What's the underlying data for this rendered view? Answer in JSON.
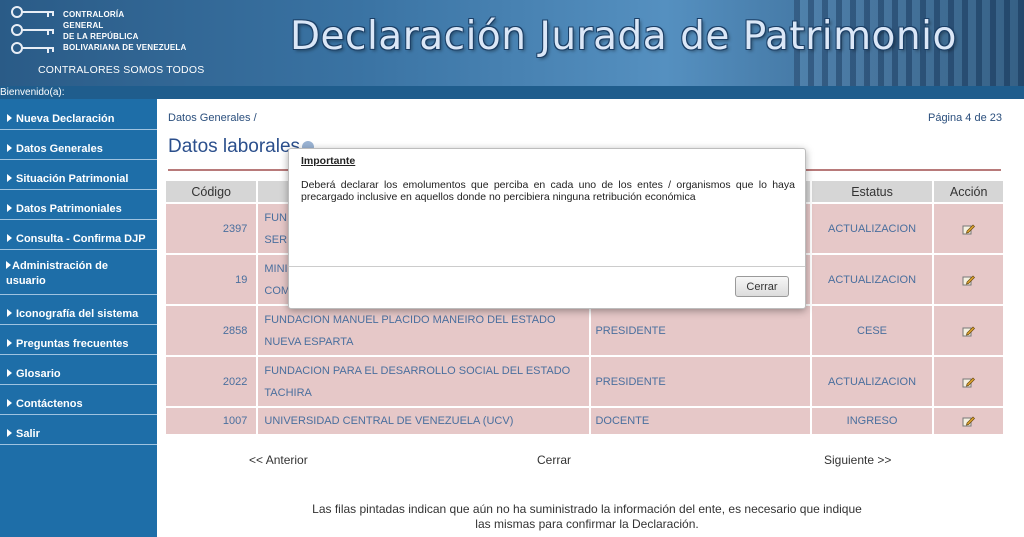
{
  "header": {
    "org_line1": "CONTRALORÍA",
    "org_line2": "GENERAL",
    "org_line3": "DE LA REPÚBLICA",
    "org_line4": "BOLIVARIANA DE VENEZUELA",
    "slogan": "CONTRALORES SOMOS TODOS",
    "title": "Declaración Jurada de Patrimonio"
  },
  "welcome": "Bienvenido(a):",
  "sidebar": {
    "items": [
      {
        "label": "Nueva Declaración"
      },
      {
        "label": "Datos Generales"
      },
      {
        "label": "Situación Patrimonial"
      },
      {
        "label": "Datos Patrimoniales"
      },
      {
        "label": "Consulta - Confirma DJP"
      },
      {
        "label": "Administración de usuario"
      },
      {
        "label": "Iconografía del sistema"
      },
      {
        "label": "Preguntas frecuentes"
      },
      {
        "label": "Glosario"
      },
      {
        "label": "Contáctenos"
      },
      {
        "label": "Salir"
      }
    ]
  },
  "main": {
    "breadcrumb": "Datos Generales /",
    "page_indicator": "Página 4 de 23",
    "section_title": "Datos laborales",
    "table": {
      "headers": {
        "codigo": "Código",
        "ente": "",
        "cargo": "",
        "estatus": "Estatus",
        "accion": "Acción"
      },
      "rows": [
        {
          "codigo": "2397",
          "ente_l1": "FUN",
          "ente_l2": "SER",
          "cargo": "",
          "estatus": "ACTUALIZACION"
        },
        {
          "codigo": "19",
          "ente_l1": "MINI",
          "ente_l2": "COM",
          "cargo": "",
          "estatus": "ACTUALIZACION"
        },
        {
          "codigo": "2858",
          "ente_l1": "FUNDACION MANUEL PLACIDO MANEIRO DEL ESTADO",
          "ente_l2": "NUEVA ESPARTA",
          "cargo": "PRESIDENTE",
          "estatus": "CESE"
        },
        {
          "codigo": "2022",
          "ente_l1": "FUNDACION PARA EL DESARROLLO SOCIAL DEL ESTADO",
          "ente_l2": "TACHIRA",
          "cargo": "PRESIDENTE",
          "estatus": "ACTUALIZACION"
        },
        {
          "codigo": "1007",
          "ente_l1": "UNIVERSIDAD CENTRAL DE VENEZUELA (UCV)",
          "ente_l2": "",
          "cargo": "DOCENTE",
          "estatus": "INGRESO"
        }
      ]
    },
    "pager": {
      "prev": "<< Anterior",
      "close": "Cerrar",
      "next": "Siguiente >>"
    },
    "footnote_l1": "Las filas pintadas indican que aún no ha suministrado la información del ente, es necesario que indique",
    "footnote_l2": "las mismas para confirmar la Declaración."
  },
  "modal": {
    "title": "Importante",
    "body": "Deberá declarar los emolumentos que perciba en cada uno de los entes / organismos que lo haya precargado inclusive en aquellos donde no percibiera ninguna retribución económica",
    "close_label": "Cerrar"
  },
  "colors": {
    "sidebar_bg": "#1e6ea8",
    "row_bg": "#e6c8c8",
    "link_text": "#4a6f9e",
    "title_text": "#2b4f8c"
  }
}
